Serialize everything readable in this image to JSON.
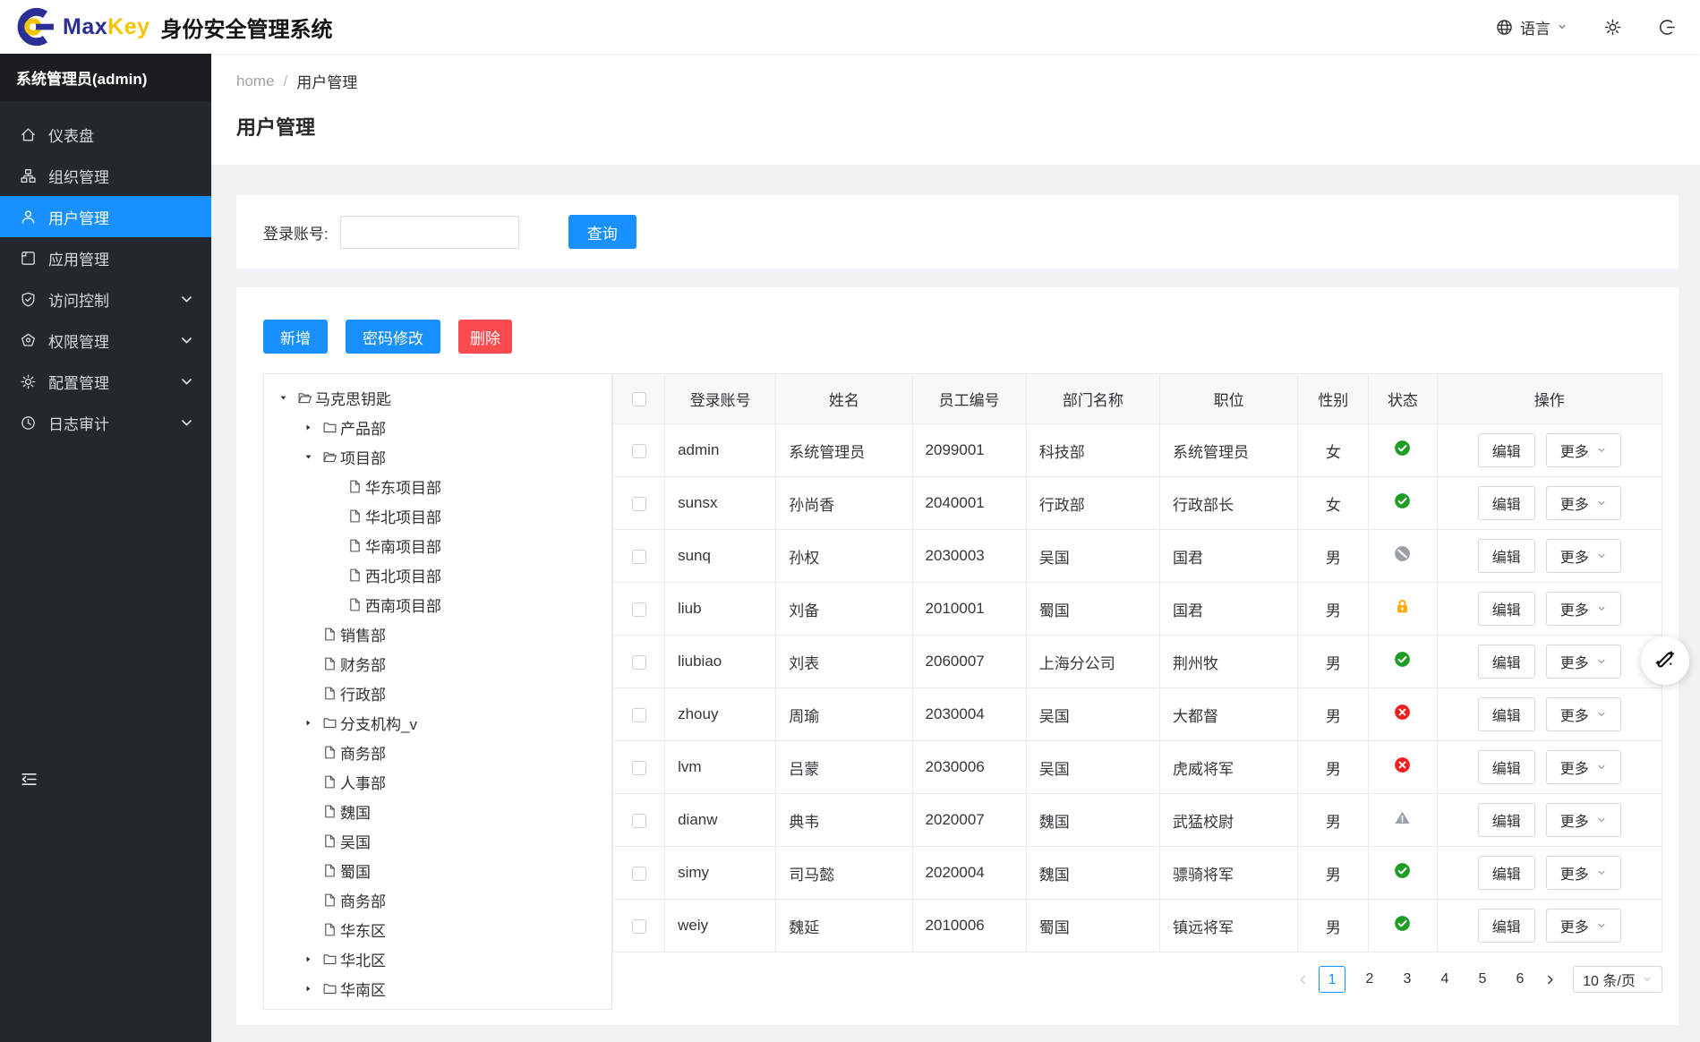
{
  "header": {
    "brand": {
      "max": "Max",
      "key": "Key",
      "title": "身份安全管理系统"
    },
    "actions": {
      "language_label": "语言"
    }
  },
  "sidebar": {
    "user": "系统管理员(admin)",
    "items": [
      {
        "icon": "dashboard-icon",
        "label": "仪表盘",
        "active": false,
        "chevron": false
      },
      {
        "icon": "org-icon",
        "label": "组织管理",
        "active": false,
        "chevron": false
      },
      {
        "icon": "user-icon",
        "label": "用户管理",
        "active": true,
        "chevron": false
      },
      {
        "icon": "app-icon",
        "label": "应用管理",
        "active": false,
        "chevron": false
      },
      {
        "icon": "shield-check-icon",
        "label": "访问控制",
        "active": false,
        "chevron": true
      },
      {
        "icon": "badge-icon",
        "label": "权限管理",
        "active": false,
        "chevron": true
      },
      {
        "icon": "gear-icon",
        "label": "配置管理",
        "active": false,
        "chevron": true
      },
      {
        "icon": "clock-icon",
        "label": "日志审计",
        "active": false,
        "chevron": true
      }
    ]
  },
  "breadcrumb": {
    "home": "home",
    "separator": "/",
    "current": "用户管理"
  },
  "page": {
    "title": "用户管理"
  },
  "search": {
    "label": "登录账号:",
    "value": "",
    "button": "查询"
  },
  "toolbar": {
    "add": "新增",
    "change_password": "密码修改",
    "delete": "删除"
  },
  "tree": {
    "items": [
      {
        "level": 0,
        "caret": "down",
        "icon": "folder-open-icon",
        "label": "马克思钥匙"
      },
      {
        "level": 1,
        "caret": "right",
        "icon": "folder-icon",
        "label": "产品部"
      },
      {
        "level": 1,
        "caret": "down",
        "icon": "folder-open-icon",
        "label": "项目部"
      },
      {
        "level": 2,
        "caret": null,
        "icon": "file-icon",
        "label": "华东项目部"
      },
      {
        "level": 2,
        "caret": null,
        "icon": "file-icon",
        "label": "华北项目部"
      },
      {
        "level": 2,
        "caret": null,
        "icon": "file-icon",
        "label": "华南项目部"
      },
      {
        "level": 2,
        "caret": null,
        "icon": "file-icon",
        "label": "西北项目部"
      },
      {
        "level": 2,
        "caret": null,
        "icon": "file-icon",
        "label": "西南项目部"
      },
      {
        "level": 1,
        "caret": null,
        "icon": "file-icon",
        "label": "销售部"
      },
      {
        "level": 1,
        "caret": null,
        "icon": "file-icon",
        "label": "财务部"
      },
      {
        "level": 1,
        "caret": null,
        "icon": "file-icon",
        "label": "行政部"
      },
      {
        "level": 1,
        "caret": "right",
        "icon": "folder-icon",
        "label": "分支机构_v"
      },
      {
        "level": 1,
        "caret": null,
        "icon": "file-icon",
        "label": "商务部"
      },
      {
        "level": 1,
        "caret": null,
        "icon": "file-icon",
        "label": "人事部"
      },
      {
        "level": 1,
        "caret": null,
        "icon": "file-icon",
        "label": "魏国"
      },
      {
        "level": 1,
        "caret": null,
        "icon": "file-icon",
        "label": "吴国"
      },
      {
        "level": 1,
        "caret": null,
        "icon": "file-icon",
        "label": "蜀国"
      },
      {
        "level": 1,
        "caret": null,
        "icon": "file-icon",
        "label": "商务部"
      },
      {
        "level": 1,
        "caret": null,
        "icon": "file-icon",
        "label": "华东区"
      },
      {
        "level": 1,
        "caret": "right",
        "icon": "folder-icon",
        "label": "华北区"
      },
      {
        "level": 1,
        "caret": "right",
        "icon": "folder-icon",
        "label": "华南区"
      }
    ]
  },
  "table": {
    "columns": [
      "登录账号",
      "姓名",
      "员工编号",
      "部门名称",
      "职位",
      "性别",
      "状态",
      "操作"
    ],
    "edit_label": "编辑",
    "more_label": "更多",
    "rows": [
      {
        "login": "admin",
        "name": "系统管理员",
        "employee_no": "2099001",
        "department": "科技部",
        "position": "系统管理员",
        "gender": "女",
        "status": "active"
      },
      {
        "login": "sunsx",
        "name": "孙尚香",
        "employee_no": "2040001",
        "department": "行政部",
        "position": "行政部长",
        "gender": "女",
        "status": "active"
      },
      {
        "login": "sunq",
        "name": "孙权",
        "employee_no": "2030003",
        "department": "吴国",
        "position": "国君",
        "gender": "男",
        "status": "disabled"
      },
      {
        "login": "liub",
        "name": "刘备",
        "employee_no": "2010001",
        "department": "蜀国",
        "position": "国君",
        "gender": "男",
        "status": "locked"
      },
      {
        "login": "liubiao",
        "name": "刘表",
        "employee_no": "2060007",
        "department": "上海分公司",
        "position": "荆州牧",
        "gender": "男",
        "status": "active"
      },
      {
        "login": "zhouy",
        "name": "周瑜",
        "employee_no": "2030004",
        "department": "吴国",
        "position": "大都督",
        "gender": "男",
        "status": "error"
      },
      {
        "login": "lvm",
        "name": "吕蒙",
        "employee_no": "2030006",
        "department": "吴国",
        "position": "虎威将军",
        "gender": "男",
        "status": "error"
      },
      {
        "login": "dianw",
        "name": "典韦",
        "employee_no": "2020007",
        "department": "魏国",
        "position": "武猛校尉",
        "gender": "男",
        "status": "warning"
      },
      {
        "login": "simy",
        "name": "司马懿",
        "employee_no": "2020004",
        "department": "魏国",
        "position": "骠骑将军",
        "gender": "男",
        "status": "active"
      },
      {
        "login": "weiy",
        "name": "魏延",
        "employee_no": "2010006",
        "department": "蜀国",
        "position": "镇远将军",
        "gender": "男",
        "status": "active"
      }
    ]
  },
  "pagination": {
    "pages": [
      "1",
      "2",
      "3",
      "4",
      "5",
      "6"
    ],
    "active": "1",
    "page_size": "10 条/页"
  },
  "colors": {
    "accent": "#1890ff",
    "danger": "#fc4b4e",
    "status_active": "#1f9d25",
    "status_error": "#f01e1e",
    "status_disabled": "#9aa0a6",
    "status_locked": "#ffa800",
    "status_warning": "#9aa0a6"
  }
}
